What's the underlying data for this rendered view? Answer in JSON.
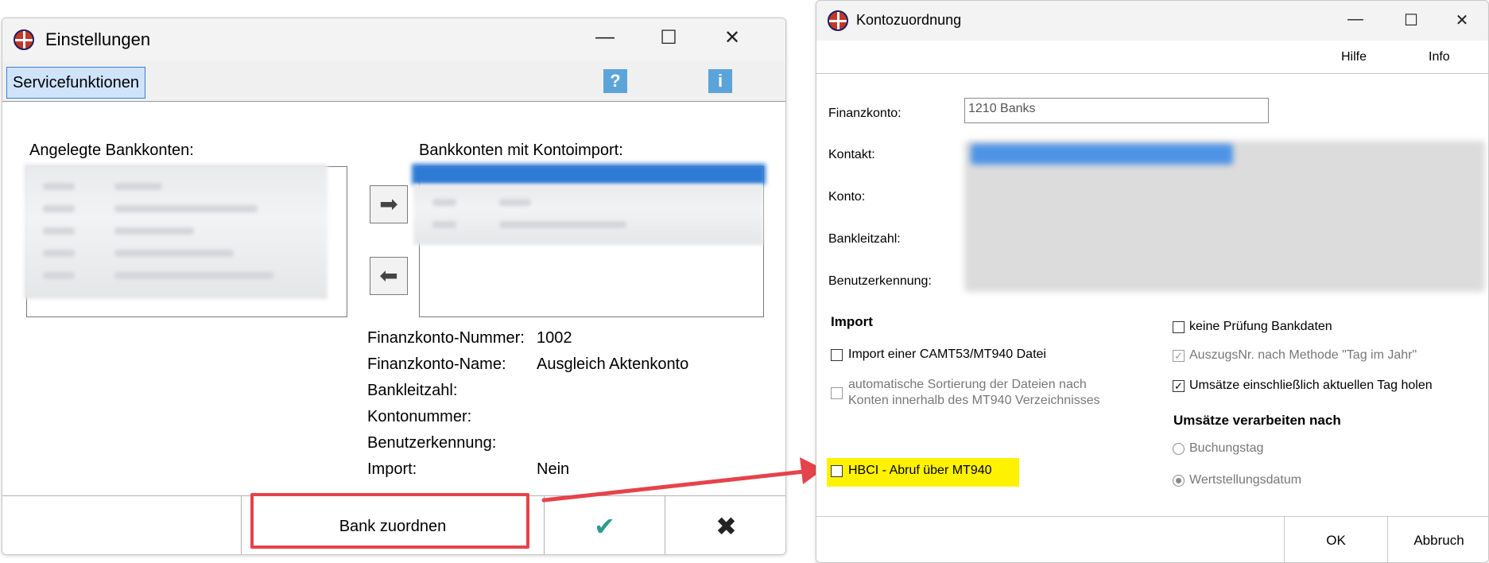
{
  "colors": {
    "highlight_red": "#e5434b",
    "highlight_yellow": "#fff200",
    "check_teal": "#2e9b8f",
    "selection_blue": "#2e7bd6"
  },
  "einstellungen": {
    "title": "Einstellungen",
    "controls": {
      "minimize": "—",
      "maximize": "☐",
      "close": "✕"
    },
    "menu": {
      "servicefunktionen": "Servicefunktionen",
      "help_glyph": "?",
      "info_glyph": "i"
    },
    "left_list_label": "Angelegte Bankkonten:",
    "right_list_label": "Bankkonten mit Kontoimport:",
    "move_right_glyph": "➡",
    "move_left_glyph": "⬅",
    "details": [
      {
        "label": "Finanzkonto-Nummer:",
        "value": "1002"
      },
      {
        "label": "Finanzkonto-Name:",
        "value": "Ausgleich Aktenkonto"
      },
      {
        "label": "Bankleitzahl:",
        "value": ""
      },
      {
        "label": "Kontonummer:",
        "value": ""
      },
      {
        "label": "Benutzerkennung:",
        "value": ""
      },
      {
        "label": "Import:",
        "value": "Nein"
      }
    ],
    "footer": {
      "bank_zuordnen": "Bank zuordnen",
      "ok_glyph": "✔",
      "cancel_glyph": "✖"
    }
  },
  "kontozuordnung": {
    "title": "Kontozuordnung",
    "controls": {
      "minimize": "—",
      "maximize": "☐",
      "close": "✕"
    },
    "menu": {
      "hilfe": "Hilfe",
      "info": "Info"
    },
    "fields": {
      "finanzkonto_label": "Finanzkonto:",
      "finanzkonto_value": "1210 Banks",
      "kontakt_label": "Kontakt:",
      "konto_label": "Konto:",
      "bankleitzahl_label": "Bankleitzahl:",
      "benutzerkennung_label": "Benutzerkennung:"
    },
    "import": {
      "header": "Import",
      "camt_label": "Import einer CAMT53/MT940 Datei",
      "camt_checked": false,
      "sort_label_1": "automatische Sortierung der Dateien nach",
      "sort_label_2": "Konten innerhalb des MT940 Verzeichnisses",
      "sort_checked": false,
      "hbci_label": "HBCI - Abruf über  MT940",
      "hbci_checked": false
    },
    "options": {
      "keine_pruefung": "keine Prüfung Bankdaten",
      "keine_pruefung_checked": false,
      "auszugsnr": "AuszugsNr. nach Methode \"Tag im Jahr\"",
      "auszugsnr_checked": true,
      "umsaetze_heute": "Umsätze einschließlich aktuellen Tag holen",
      "umsaetze_heute_checked": true,
      "verarbeiten_header": "Umsätze verarbeiten nach",
      "buchungstag": "Buchungstag",
      "wertstellungsdatum": "Wertstellungsdatum",
      "selected": "Wertstellungsdatum"
    },
    "footer": {
      "ok": "OK",
      "abbruch": "Abbruch"
    },
    "check_glyph": "✓"
  }
}
